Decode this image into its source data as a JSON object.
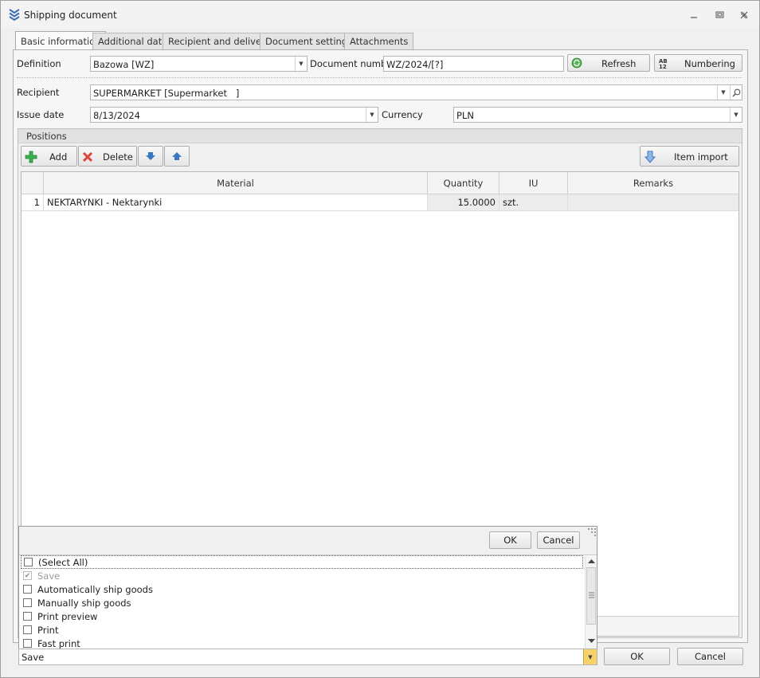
{
  "window": {
    "title": "Shipping document"
  },
  "tabs": [
    {
      "label": "Basic information",
      "active": true
    },
    {
      "label": "Additional data"
    },
    {
      "label": "Recipient and delivery"
    },
    {
      "label": "Document settings"
    },
    {
      "label": "Attachments"
    }
  ],
  "form": {
    "definition_label": "Definition",
    "definition_value": "Bazowa [WZ]",
    "document_number_label": "Document number",
    "document_number_value": "WZ/2024/[?]",
    "refresh_label": "Refresh",
    "numbering_label": "Numbering",
    "recipient_label": "Recipient",
    "recipient_value": "SUPERMARKET [Supermarket   ]",
    "issue_date_label": "Issue date",
    "issue_date_value": "8/13/2024",
    "currency_label": "Currency",
    "currency_value": "PLN"
  },
  "positions": {
    "title": "Positions",
    "add_label": "Add",
    "delete_label": "Delete",
    "item_import_label": "Item import",
    "columns": [
      "Material",
      "Quantity",
      "IU",
      "Remarks"
    ],
    "rows": [
      {
        "num": "1",
        "material": "NEKTARYNKI - Nektarynki",
        "quantity": "15.0000",
        "iu": "szt.",
        "remarks": ""
      }
    ]
  },
  "popup": {
    "ok_label": "OK",
    "cancel_label": "Cancel",
    "options": [
      {
        "label": "(Select All)",
        "checked": false,
        "disabled": false
      },
      {
        "label": "Save",
        "checked": true,
        "disabled": true
      },
      {
        "label": "Automatically ship goods",
        "checked": false,
        "disabled": false
      },
      {
        "label": "Manually ship goods",
        "checked": false,
        "disabled": false
      },
      {
        "label": "Print preview",
        "checked": false,
        "disabled": false
      },
      {
        "label": "Print",
        "checked": false,
        "disabled": false
      },
      {
        "label": "Fast print",
        "checked": false,
        "disabled": false
      }
    ]
  },
  "footer": {
    "action_combo_value": "Save",
    "ok_label": "OK",
    "cancel_label": "Cancel"
  },
  "colors": {
    "accent_combo": "#f5d26b",
    "add_icon": "#2fa84f",
    "delete_icon": "#d9443b",
    "arrow_icon": "#3b78c4"
  }
}
